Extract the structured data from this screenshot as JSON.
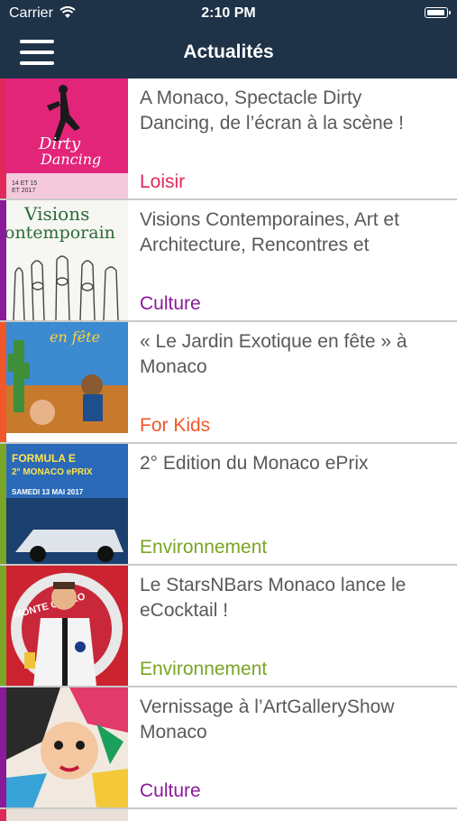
{
  "status": {
    "carrier": "Carrier",
    "time": "2:10 PM",
    "battery_level": 0.95
  },
  "nav": {
    "title": "Actualités",
    "menu_icon": "hamburger-menu-icon"
  },
  "colors": {
    "navbar": "#1e3248",
    "loisir": "#e0285a",
    "culture": "#8b1a9a",
    "kids": "#f0582a",
    "environnement": "#7aa526"
  },
  "items": [
    {
      "title": "A Monaco, Spectacle Dirty Dancing, de l’écran à la scène !",
      "category": "Loisir",
      "color": "#e0285a",
      "thumb_text": [
        "Dirty",
        "Dancing",
        "14 ET 15",
        "ET 2017"
      ]
    },
    {
      "title": "Visions Contemporaines, Art et Architecture, Rencontres et",
      "category": "Culture",
      "color": "#8b1a9a",
      "thumb_text": [
        "Visions",
        "ontemporain"
      ]
    },
    {
      "title": "« Le Jardin Exotique en fête » à Monaco",
      "category": "For Kids",
      "color": "#f0582a",
      "thumb_text": [
        "en fête"
      ]
    },
    {
      "title": "2° Edition du Monaco ePrix",
      "category": "Environnement",
      "color": "#7aa526",
      "thumb_text": [
        "FORMULA E",
        "2° MONACO ePRIX",
        "SAMEDI 13 MAI 2017"
      ]
    },
    {
      "title": "Le StarsNBars Monaco lance le eCocktail !",
      "category": "Environnement",
      "color": "#7aa526",
      "thumb_text": [
        "MONTE CARLO"
      ]
    },
    {
      "title": "Vernissage à l’ArtGalleryShow Monaco",
      "category": "Culture",
      "color": "#8b1a9a",
      "thumb_text": []
    }
  ]
}
